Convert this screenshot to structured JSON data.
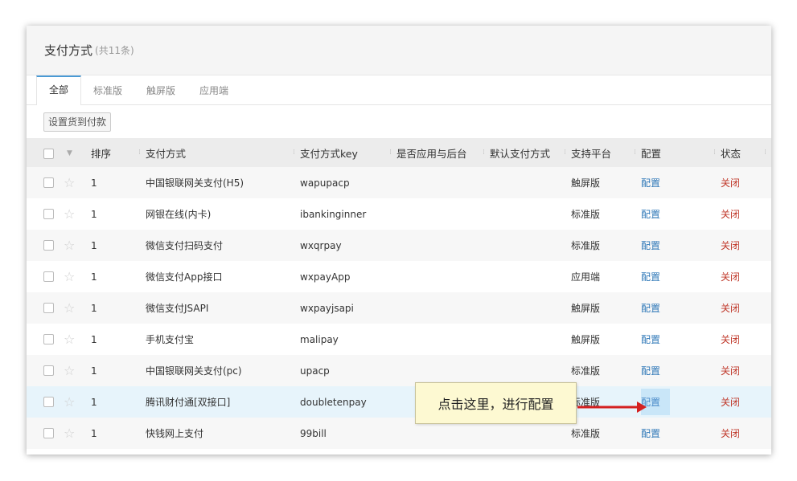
{
  "header": {
    "title": "支付方式",
    "count": "(共11条)"
  },
  "tabs": [
    {
      "label": "全部",
      "active": true
    },
    {
      "label": "标准版",
      "active": false
    },
    {
      "label": "触屏版",
      "active": false
    },
    {
      "label": "应用端",
      "active": false
    }
  ],
  "toolbar": {
    "cod_button": "设置货到付款"
  },
  "columns": {
    "order": "排序",
    "method": "支付方式",
    "key": "支付方式key",
    "backend": "是否应用与后台",
    "default": "默认支付方式",
    "platform": "支持平台",
    "config": "配置",
    "status": "状态"
  },
  "rows": [
    {
      "order": "1",
      "method": "中国银联网关支付(H5)",
      "key": "wapupacp",
      "backend": "",
      "default": "",
      "platform": "触屏版",
      "config": "配置",
      "status": "关闭"
    },
    {
      "order": "1",
      "method": "网银在线(内卡)",
      "key": "ibankinginner",
      "backend": "",
      "default": "",
      "platform": "标准版",
      "config": "配置",
      "status": "关闭"
    },
    {
      "order": "1",
      "method": "微信支付扫码支付",
      "key": "wxqrpay",
      "backend": "",
      "default": "",
      "platform": "标准版",
      "config": "配置",
      "status": "关闭"
    },
    {
      "order": "1",
      "method": "微信支付App接口",
      "key": "wxpayApp",
      "backend": "",
      "default": "",
      "platform": "应用端",
      "config": "配置",
      "status": "关闭"
    },
    {
      "order": "1",
      "method": "微信支付JSAPI",
      "key": "wxpayjsapi",
      "backend": "",
      "default": "",
      "platform": "触屏版",
      "config": "配置",
      "status": "关闭"
    },
    {
      "order": "1",
      "method": "手机支付宝",
      "key": "malipay",
      "backend": "",
      "default": "",
      "platform": "触屏版",
      "config": "配置",
      "status": "关闭"
    },
    {
      "order": "1",
      "method": "中国银联网关支付(pc)",
      "key": "upacp",
      "backend": "",
      "default": "",
      "platform": "标准版",
      "config": "配置",
      "status": "关闭"
    },
    {
      "order": "1",
      "method": "腾讯财付通[双接口]",
      "key": "doubletenpay",
      "backend": "",
      "default": "",
      "platform": "标准版",
      "config": "配置",
      "status": "关闭"
    },
    {
      "order": "1",
      "method": "快钱网上支付",
      "key": "99bill",
      "backend": "",
      "default": "",
      "platform": "标准版",
      "config": "配置",
      "status": "关闭"
    }
  ],
  "callout": {
    "text": "点击这里，进行配置"
  },
  "colors": {
    "accent": "#4a9ad4",
    "link": "#2f78b8",
    "close": "#c0392b",
    "arrow": "#d42020"
  }
}
